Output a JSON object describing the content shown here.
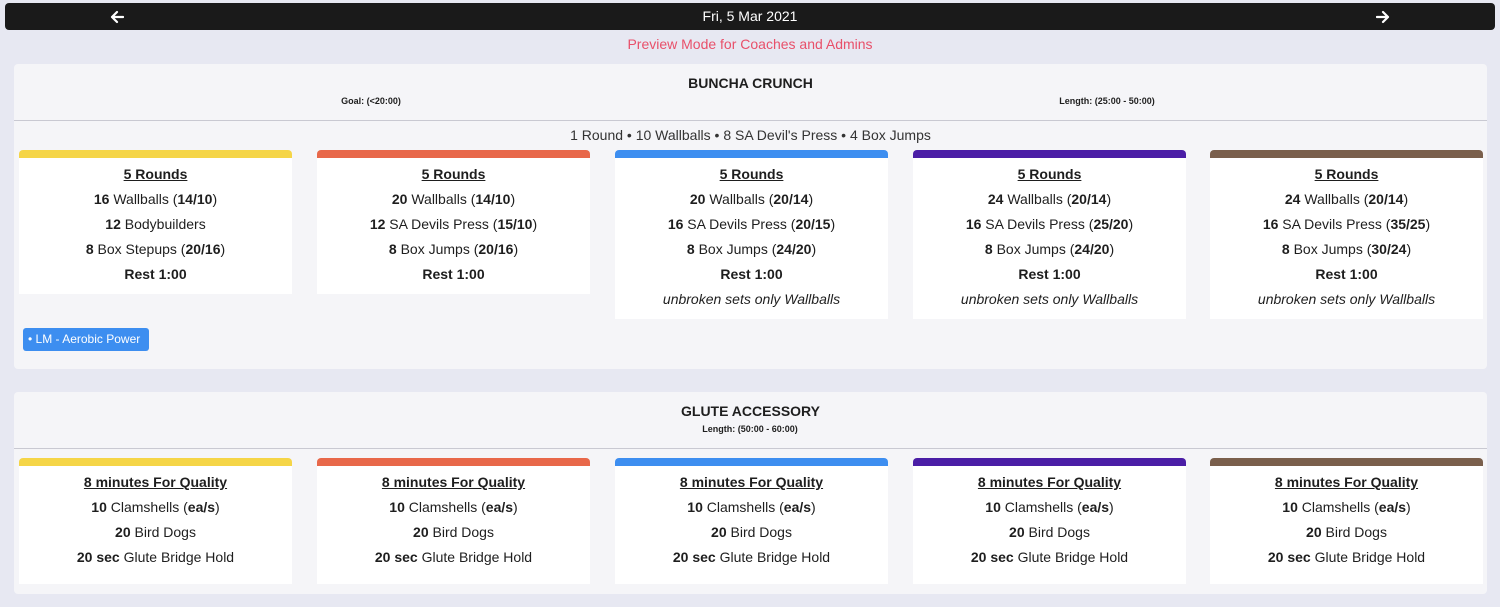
{
  "header": {
    "date": "Fri, 5 Mar 2021"
  },
  "preview_text": "Preview Mode for Coaches and Admins",
  "colors": {
    "track1": "#f5d547",
    "track2": "#e8684a",
    "track3": "#3d8ef0",
    "track4": "#4b1ea6",
    "track5": "#7a5f4c"
  },
  "workouts": [
    {
      "title": "BUNCHA CRUNCH",
      "goal": "Goal: (<20:00)",
      "length": "Length: (25:00 - 50:00)",
      "summary": "1 Round • 10 Wallballs • 8 SA Devil's Press • 4 Box Jumps",
      "tag": "• LM - Aerobic Power",
      "cards": [
        {
          "heading": "5 Rounds",
          "lines": [
            {
              "bold": "16",
              "text": " Wallballs (",
              "bold2": "14/10",
              "text2": ")"
            },
            {
              "bold": "12",
              "text": " Bodybuilders",
              "bold2": "",
              "text2": ""
            },
            {
              "bold": "8",
              "text": " Box Stepups (",
              "bold2": "20/16",
              "text2": ")"
            },
            {
              "bold": "Rest 1:00",
              "text": "",
              "bold2": "",
              "text2": ""
            }
          ],
          "note": ""
        },
        {
          "heading": "5 Rounds",
          "lines": [
            {
              "bold": "20",
              "text": " Wallballs (",
              "bold2": "14/10",
              "text2": ")"
            },
            {
              "bold": "12",
              "text": " SA Devils Press (",
              "bold2": "15/10",
              "text2": ")"
            },
            {
              "bold": "8",
              "text": " Box Jumps (",
              "bold2": "20/16",
              "text2": ")"
            },
            {
              "bold": "Rest 1:00",
              "text": "",
              "bold2": "",
              "text2": ""
            }
          ],
          "note": ""
        },
        {
          "heading": "5 Rounds",
          "lines": [
            {
              "bold": "20",
              "text": " Wallballs (",
              "bold2": "20/14",
              "text2": ")"
            },
            {
              "bold": "16",
              "text": " SA Devils Press (",
              "bold2": "20/15",
              "text2": ")"
            },
            {
              "bold": "8",
              "text": " Box Jumps (",
              "bold2": "24/20",
              "text2": ")"
            },
            {
              "bold": "Rest 1:00",
              "text": "",
              "bold2": "",
              "text2": ""
            }
          ],
          "note": "unbroken sets only Wallballs"
        },
        {
          "heading": "5 Rounds",
          "lines": [
            {
              "bold": "24",
              "text": " Wallballs (",
              "bold2": "20/14",
              "text2": ")"
            },
            {
              "bold": "16",
              "text": " SA Devils Press (",
              "bold2": "25/20",
              "text2": ")"
            },
            {
              "bold": "8",
              "text": " Box Jumps (",
              "bold2": "24/20",
              "text2": ")"
            },
            {
              "bold": "Rest 1:00",
              "text": "",
              "bold2": "",
              "text2": ""
            }
          ],
          "note": "unbroken sets only Wallballs"
        },
        {
          "heading": "5 Rounds",
          "lines": [
            {
              "bold": "24",
              "text": " Wallballs (",
              "bold2": "20/14",
              "text2": ")"
            },
            {
              "bold": "16",
              "text": " SA Devils Press (",
              "bold2": "35/25",
              "text2": ")"
            },
            {
              "bold": "8",
              "text": " Box Jumps (",
              "bold2": "30/24",
              "text2": ")"
            },
            {
              "bold": "Rest 1:00",
              "text": "",
              "bold2": "",
              "text2": ""
            }
          ],
          "note": "unbroken sets only Wallballs"
        }
      ]
    },
    {
      "title": "GLUTE ACCESSORY",
      "length": "Length: (50:00 - 60:00)",
      "cards": [
        {
          "heading": "8 minutes For Quality",
          "lines": [
            {
              "bold": "10",
              "text": " Clamshells (",
              "bold2": "ea/s",
              "text2": ")"
            },
            {
              "bold": "20",
              "text": " Bird Dogs",
              "bold2": "",
              "text2": ""
            },
            {
              "bold": "20 sec",
              "text": " Glute Bridge  Hold",
              "bold2": "",
              "text2": ""
            }
          ]
        },
        {
          "heading": "8 minutes For Quality",
          "lines": [
            {
              "bold": "10",
              "text": " Clamshells (",
              "bold2": "ea/s",
              "text2": ")"
            },
            {
              "bold": "20",
              "text": " Bird Dogs",
              "bold2": "",
              "text2": ""
            },
            {
              "bold": "20 sec",
              "text": " Glute Bridge  Hold",
              "bold2": "",
              "text2": ""
            }
          ]
        },
        {
          "heading": "8 minutes For Quality",
          "lines": [
            {
              "bold": "10",
              "text": " Clamshells (",
              "bold2": "ea/s",
              "text2": ")"
            },
            {
              "bold": "20",
              "text": " Bird Dogs",
              "bold2": "",
              "text2": ""
            },
            {
              "bold": "20 sec",
              "text": " Glute Bridge  Hold",
              "bold2": "",
              "text2": ""
            }
          ]
        },
        {
          "heading": "8 minutes For Quality",
          "lines": [
            {
              "bold": "10",
              "text": " Clamshells (",
              "bold2": "ea/s",
              "text2": ")"
            },
            {
              "bold": "20",
              "text": " Bird Dogs",
              "bold2": "",
              "text2": ""
            },
            {
              "bold": "20 sec",
              "text": " Glute Bridge  Hold",
              "bold2": "",
              "text2": ""
            }
          ]
        },
        {
          "heading": "8 minutes For Quality",
          "lines": [
            {
              "bold": "10",
              "text": " Clamshells (",
              "bold2": "ea/s",
              "text2": ")"
            },
            {
              "bold": "20",
              "text": " Bird Dogs",
              "bold2": "",
              "text2": ""
            },
            {
              "bold": "20 sec",
              "text": " Glute Bridge  Hold",
              "bold2": "",
              "text2": ""
            }
          ]
        }
      ]
    }
  ]
}
